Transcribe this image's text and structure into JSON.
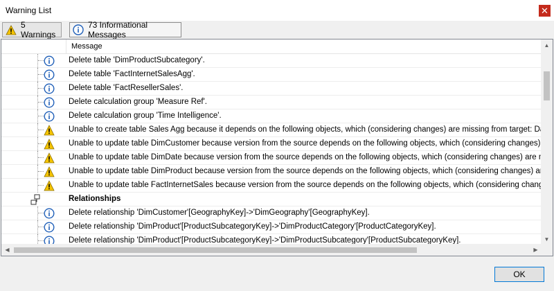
{
  "window": {
    "title": "Warning List"
  },
  "toolbar": {
    "warnings_label": "5 Warnings",
    "info_label": "73 Informational Messages"
  },
  "list": {
    "column_header": "Message",
    "rows": [
      {
        "type": "info",
        "text": "Delete table 'DimProductSubcategory'."
      },
      {
        "type": "info",
        "text": "Delete table 'FactInternetSalesAgg'."
      },
      {
        "type": "info",
        "text": "Delete table 'FactResellerSales'."
      },
      {
        "type": "info",
        "text": "Delete calculation group 'Measure Ref'."
      },
      {
        "type": "info",
        "text": "Delete calculation group 'Time Intelligence'."
      },
      {
        "type": "warning",
        "text": "Unable to create table Sales Agg because it depends on the following objects, which (considering changes) are missing from target: Data Source ("
      },
      {
        "type": "warning",
        "text": "Unable to update table DimCustomer because version from the source depends on the following objects, which (considering changes) are missing"
      },
      {
        "type": "warning",
        "text": "Unable to update table DimDate because version from the source depends on the following objects, which (considering changes) are missing from"
      },
      {
        "type": "warning",
        "text": "Unable to update table DimProduct because version from the source depends on the following objects, which (considering changes) are missing fr"
      },
      {
        "type": "warning",
        "text": "Unable to update table FactInternetSales because version from the source depends on the following objects, which (considering changes) are mis"
      },
      {
        "type": "group",
        "text": "Relationships"
      },
      {
        "type": "info",
        "text": "Delete relationship 'DimCustomer'[GeographyKey]->'DimGeography'[GeographyKey]."
      },
      {
        "type": "info",
        "text": "Delete relationship 'DimProduct'[ProductSubcategoryKey]->'DimProductCategory'[ProductCategoryKey]."
      },
      {
        "type": "info",
        "text": "Delete relationship 'DimProduct'[ProductSubcategoryKey]->'DimProductSubcategory'[ProductSubcategoryKey]."
      }
    ]
  },
  "footer": {
    "ok_label": "OK"
  },
  "colors": {
    "warning": "#f5c400",
    "info": "#1f5fb8",
    "accent": "#0078d7"
  },
  "icons": {
    "warning": "warning-icon",
    "info": "info-icon",
    "group": "relationship-group-icon",
    "close": "close-icon"
  }
}
